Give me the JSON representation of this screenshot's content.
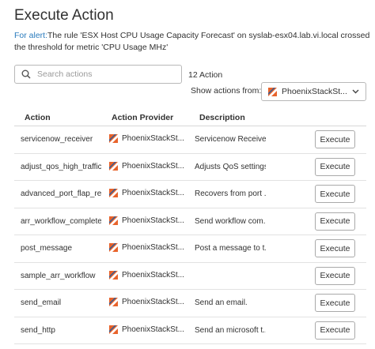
{
  "header": {
    "title": "Execute Action"
  },
  "alert": {
    "prefix": "For alert:",
    "text": "The rule 'ESX Host CPU Usage Capacity Forecast' on syslab-esx04.lab.vi.local crossed the threshold for metric 'CPU Usage MHz'"
  },
  "search": {
    "placeholder": "Search actions",
    "value": ""
  },
  "action_count": "12 Action",
  "filter": {
    "label": "Show actions from:",
    "selected": "PhoenixStackSt..."
  },
  "colors": {
    "accent": "#2a7bbd",
    "provider_icon_orange": "#e8632b",
    "provider_icon_blue": "#2a5d9c"
  },
  "table": {
    "columns": [
      "Action",
      "Action Provider",
      "Description"
    ],
    "button_label": "Execute",
    "rows": [
      {
        "action": "servicenow_receiver",
        "provider": "PhoenixStackSt...",
        "description": "Servicenow Receiver"
      },
      {
        "action": "adjust_qos_high_traffic",
        "provider": "PhoenixStackSt...",
        "description": "Adjusts QoS settings..."
      },
      {
        "action": "advanced_port_flap_recovery",
        "provider": "PhoenixStackSt...",
        "description": "Recovers from port ..."
      },
      {
        "action": "arr_workflow_completed_",
        "provider": "PhoenixStackSt...",
        "description": "Send workflow com..."
      },
      {
        "action": "post_message",
        "provider": "PhoenixStackSt...",
        "description": "Post a message to t..."
      },
      {
        "action": "sample_arr_workflow",
        "provider": "PhoenixStackSt...",
        "description": ""
      },
      {
        "action": "send_email",
        "provider": "PhoenixStackSt...",
        "description": "Send an email."
      },
      {
        "action": "send_http",
        "provider": "PhoenixStackSt...",
        "description": "Send an microsoft t..."
      }
    ]
  }
}
